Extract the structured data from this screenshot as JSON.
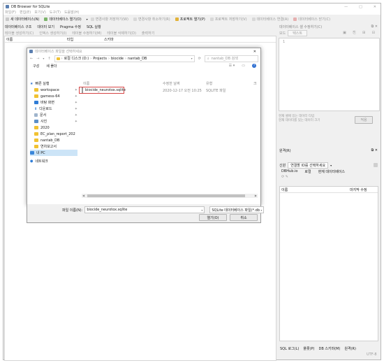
{
  "app": {
    "title": "DB Browser for SQLite",
    "controls": [
      "—",
      "□",
      "✕"
    ]
  },
  "menubar": [
    "파일(F)",
    "편집(E)",
    "보기(V)",
    "도구(T)",
    "도움말(H)"
  ],
  "toolbar": [
    {
      "label": "새 데이터베이스(N)",
      "icon": "new-db-icon",
      "enabled": true
    },
    {
      "label": "데이터베이스 열기(O)",
      "icon": "open-db-icon",
      "enabled": true
    },
    {
      "label": "변경사항 저장하기(W)",
      "icon": "write-changes-icon",
      "enabled": false
    },
    {
      "label": "변경사항 취소하기(R)",
      "icon": "revert-changes-icon",
      "enabled": false
    },
    {
      "label": "프로젝트 열기(P)",
      "icon": "open-project-icon",
      "enabled": true
    },
    {
      "label": "프로젝트 저장하기(V)",
      "icon": "save-project-icon",
      "enabled": false
    },
    {
      "label": "데이터베이스 연결(A)",
      "icon": "attach-db-icon",
      "enabled": false
    },
    {
      "label": "데이터베이스 닫기(C)",
      "icon": "close-db-icon",
      "enabled": false
    }
  ],
  "tabs": [
    "데이터베이스 구조",
    "데이터 보기",
    "Pragma 수정",
    "SQL 실행"
  ],
  "subtoolbar": [
    "테이블 생성하기(C)",
    "인덱스 생성하기(I)",
    "테이블 수정하기(M)",
    "테이블 삭제하기(D)",
    "출력하기"
  ],
  "structure_headers": [
    "이름",
    "타입",
    "스키마"
  ],
  "edit_cell_panel": {
    "title": "데이터베이스 셀 수정하기(C)",
    "mode_label": "모드",
    "mode_value": "텍스트",
    "line_number": "1",
    "status_line1": "현재 셀에 있는 데이터 타입",
    "status_line2": "현재 데이터를 있는 데이터 크기",
    "apply": "적용"
  },
  "remote_panel": {
    "title": "원격(R)",
    "identity_label": "신원",
    "identity_value": "연결할 ID를 선택하세요",
    "tabs": [
      "DBHub.io",
      "로컬",
      "현재 데이터베이스"
    ],
    "col_name": "이름",
    "col_modified": "마지막 수정"
  },
  "bottom_tabs": [
    "SQL 로그(L)",
    "플롯(P)",
    "DB 스키마(M)",
    "원격(R)"
  ],
  "status_bar": "UTF-8",
  "dialog": {
    "title": "데이터베이스 파일을 선택하세요",
    "breadcrumb": [
      "로컬 디스크 (D:)",
      "Projects",
      "biocide",
      "nantab_DB"
    ],
    "search_placeholder": "nantab_DB 검색",
    "organize": "구성",
    "new_folder": "새 폴더",
    "sidebar": [
      {
        "label": "빠른 실행",
        "icon": "star-icon"
      },
      {
        "label": "workspace",
        "icon": "folder-icon"
      },
      {
        "label": "gamess-64",
        "icon": "folder-icon"
      },
      {
        "label": "바탕 화면",
        "icon": "desktop-icon"
      },
      {
        "label": "다운로드",
        "icon": "download-icon"
      },
      {
        "label": "문서",
        "icon": "document-icon"
      },
      {
        "label": "사진",
        "icon": "pictures-icon"
      },
      {
        "label": "2020",
        "icon": "folder-icon"
      },
      {
        "label": "EC_plan_report_202",
        "icon": "folder-icon"
      },
      {
        "label": "nantab_DB",
        "icon": "folder-icon"
      },
      {
        "label": "연차보고서",
        "icon": "folder-icon"
      },
      {
        "label": "내 PC",
        "icon": "pc-icon"
      },
      {
        "label": "네트워크",
        "icon": "network-icon"
      }
    ],
    "columns": [
      "이름",
      "수정한 날짜",
      "유형",
      "크"
    ],
    "files": [
      {
        "name": "biocide_neurotox.sqlite",
        "date": "2020-12-17 오전 10:25",
        "type": "SQLITE 파일"
      }
    ],
    "filename_label": "파일 이름(N):",
    "filename_value": "biocide_neurotox.sqlite",
    "filter_value": "SQLite 데이터베이스 파일(*.db",
    "open": "열기(O)",
    "cancel": "취소"
  }
}
